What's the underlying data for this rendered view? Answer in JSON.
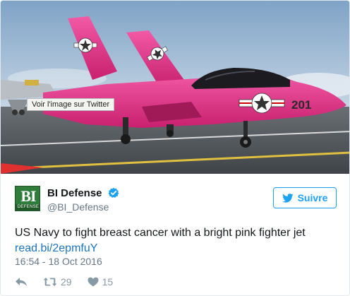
{
  "media": {
    "tooltip": "Voir l'image sur Twitter",
    "jet_number": "201",
    "colors": {
      "sky": "#a9c3dc",
      "jet": "#e8358f",
      "deck": "#4b5055"
    }
  },
  "author": {
    "avatar_text": "BI",
    "avatar_subtext": "DEFENSE",
    "name": "BI Defense",
    "handle": "@BI_Defense",
    "verified": true
  },
  "follow_button": {
    "label": "Suivre",
    "icon": "twitter-bird-icon"
  },
  "tweet": {
    "text": "US Navy to fight breast cancer with a bright pink fighter jet",
    "link": "read.bi/2epmfuY",
    "timestamp": "16:54 - 18 Oct 2016"
  },
  "actions": {
    "reply_icon": "reply-icon",
    "retweet_icon": "retweet-icon",
    "retweet_count": "29",
    "like_icon": "heart-icon",
    "like_count": "15"
  },
  "colors": {
    "accent": "#1da1f2",
    "link": "#1b75bb",
    "muted": "#657786"
  }
}
